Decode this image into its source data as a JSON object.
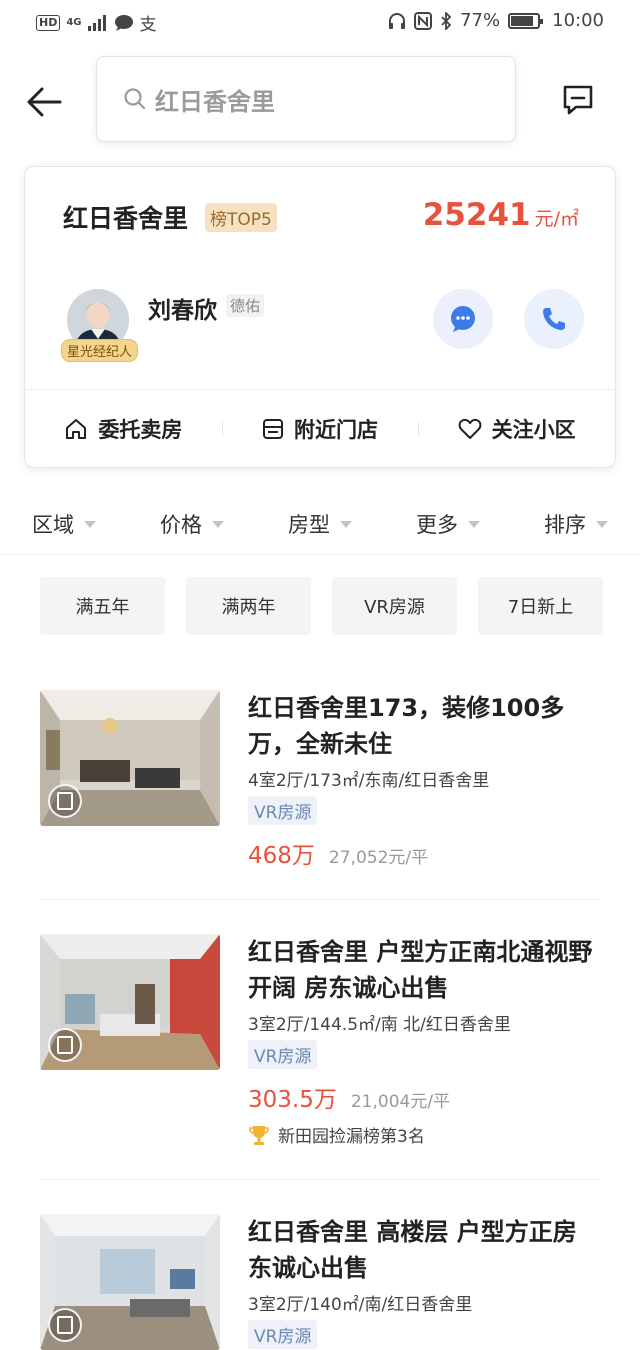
{
  "status_bar": {
    "left_hd": "HD",
    "left_net": "4G",
    "battery_text": "77%",
    "battery_level": 0.77,
    "time": "10:00"
  },
  "header": {
    "search_text": "红日香舍里"
  },
  "community_card": {
    "name": "红日香舍里",
    "rank_badge": "榜TOP5",
    "price_value": "25241",
    "price_unit": "元/㎡",
    "agent": {
      "name": "刘春欣",
      "company": "德佑",
      "star_badge": "星光经纪人"
    },
    "actions": [
      {
        "label": "委托卖房",
        "icon": "home-icon"
      },
      {
        "label": "附近门店",
        "icon": "store-icon"
      },
      {
        "label": "关注小区",
        "icon": "heart-icon"
      }
    ]
  },
  "filters": [
    {
      "label": "区域"
    },
    {
      "label": "价格"
    },
    {
      "label": "房型"
    },
    {
      "label": "更多"
    },
    {
      "label": "排序"
    }
  ],
  "quick_tags": [
    "满五年",
    "满两年",
    "VR房源",
    "7日新上"
  ],
  "listings": [
    {
      "title": "红日香舍里173，装修100多万，全新未住",
      "info": "4室2厅/173㎡/东南/红日香舍里",
      "tag": "VR房源",
      "total_price": "468万",
      "unit_price": "27,052元/平",
      "rank": ""
    },
    {
      "title": "红日香舍里 户型方正南北通视野开阔 房东诚心出售",
      "info": "3室2厅/144.5㎡/南 北/红日香舍里",
      "tag": "VR房源",
      "total_price": "303.5万",
      "unit_price": "21,004元/平",
      "rank": "新田园捡漏榜第3名"
    },
    {
      "title": "红日香舍里 高楼层 户型方正房东诚心出售",
      "info": "3室2厅/140㎡/南/红日香舍里",
      "tag": "VR房源",
      "total_price": "",
      "unit_price": "",
      "rank": ""
    }
  ],
  "colors": {
    "accent_red": "#e8513c",
    "agent_button_bg": "#eaf1fc",
    "agent_icon_blue": "#3d7be8",
    "gold_badge": "#f6e2c2"
  }
}
